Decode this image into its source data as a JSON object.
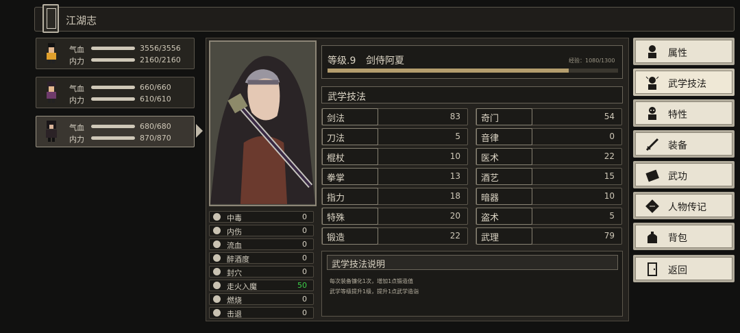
{
  "header": {
    "title": "江湖志"
  },
  "party": [
    {
      "hp_label": "气血",
      "hp": "3556/3556",
      "mp_label": "内力",
      "mp": "2160/2160"
    },
    {
      "hp_label": "气血",
      "hp": "660/660",
      "mp_label": "内力",
      "mp": "610/610"
    },
    {
      "hp_label": "气血",
      "hp": "680/680",
      "mp_label": "内力",
      "mp": "870/870"
    }
  ],
  "character": {
    "level_label": "等级.9",
    "name": "剑侍阿夏",
    "exp_text": "经验：1080/1300",
    "exp_fraction": 0.83
  },
  "status_effects": [
    {
      "name": "中毒",
      "value": "0"
    },
    {
      "name": "内伤",
      "value": "0"
    },
    {
      "name": "流血",
      "value": "0"
    },
    {
      "name": "醉酒度",
      "value": "0"
    },
    {
      "name": "封穴",
      "value": "0"
    },
    {
      "name": "走火入魔",
      "value": "50"
    },
    {
      "name": "燃烧",
      "value": "0"
    },
    {
      "name": "击退",
      "value": "0"
    }
  ],
  "skills_section": {
    "title": "武学技法"
  },
  "skills_left": [
    {
      "name": "剑法",
      "value": "83"
    },
    {
      "name": "刀法",
      "value": "5"
    },
    {
      "name": "棍杖",
      "value": "10"
    },
    {
      "name": "拳掌",
      "value": "13"
    },
    {
      "name": "指力",
      "value": "18"
    },
    {
      "name": "特殊",
      "value": "20"
    },
    {
      "name": "锻造",
      "value": "22"
    }
  ],
  "skills_right": [
    {
      "name": "奇门",
      "value": "54"
    },
    {
      "name": "音律",
      "value": "0"
    },
    {
      "name": "医术",
      "value": "22"
    },
    {
      "name": "酒艺",
      "value": "15"
    },
    {
      "name": "暗器",
      "value": "10"
    },
    {
      "name": "盗术",
      "value": "5"
    },
    {
      "name": "武理",
      "value": "79"
    }
  ],
  "description": {
    "title": "武学技法说明",
    "lines": [
      "每次装备镰化1次，增加1点锻造值",
      "武学等级提升1级，提升1点武学造诣"
    ]
  },
  "menu": [
    "属性",
    "武学技法",
    "特性",
    "装备",
    "武功",
    "人物传记",
    "背包",
    "返回"
  ],
  "colors": {
    "accent_green": "#3cd04a",
    "exp_fill": "#b59e6e",
    "menu_bg": "#e9e3d3"
  }
}
